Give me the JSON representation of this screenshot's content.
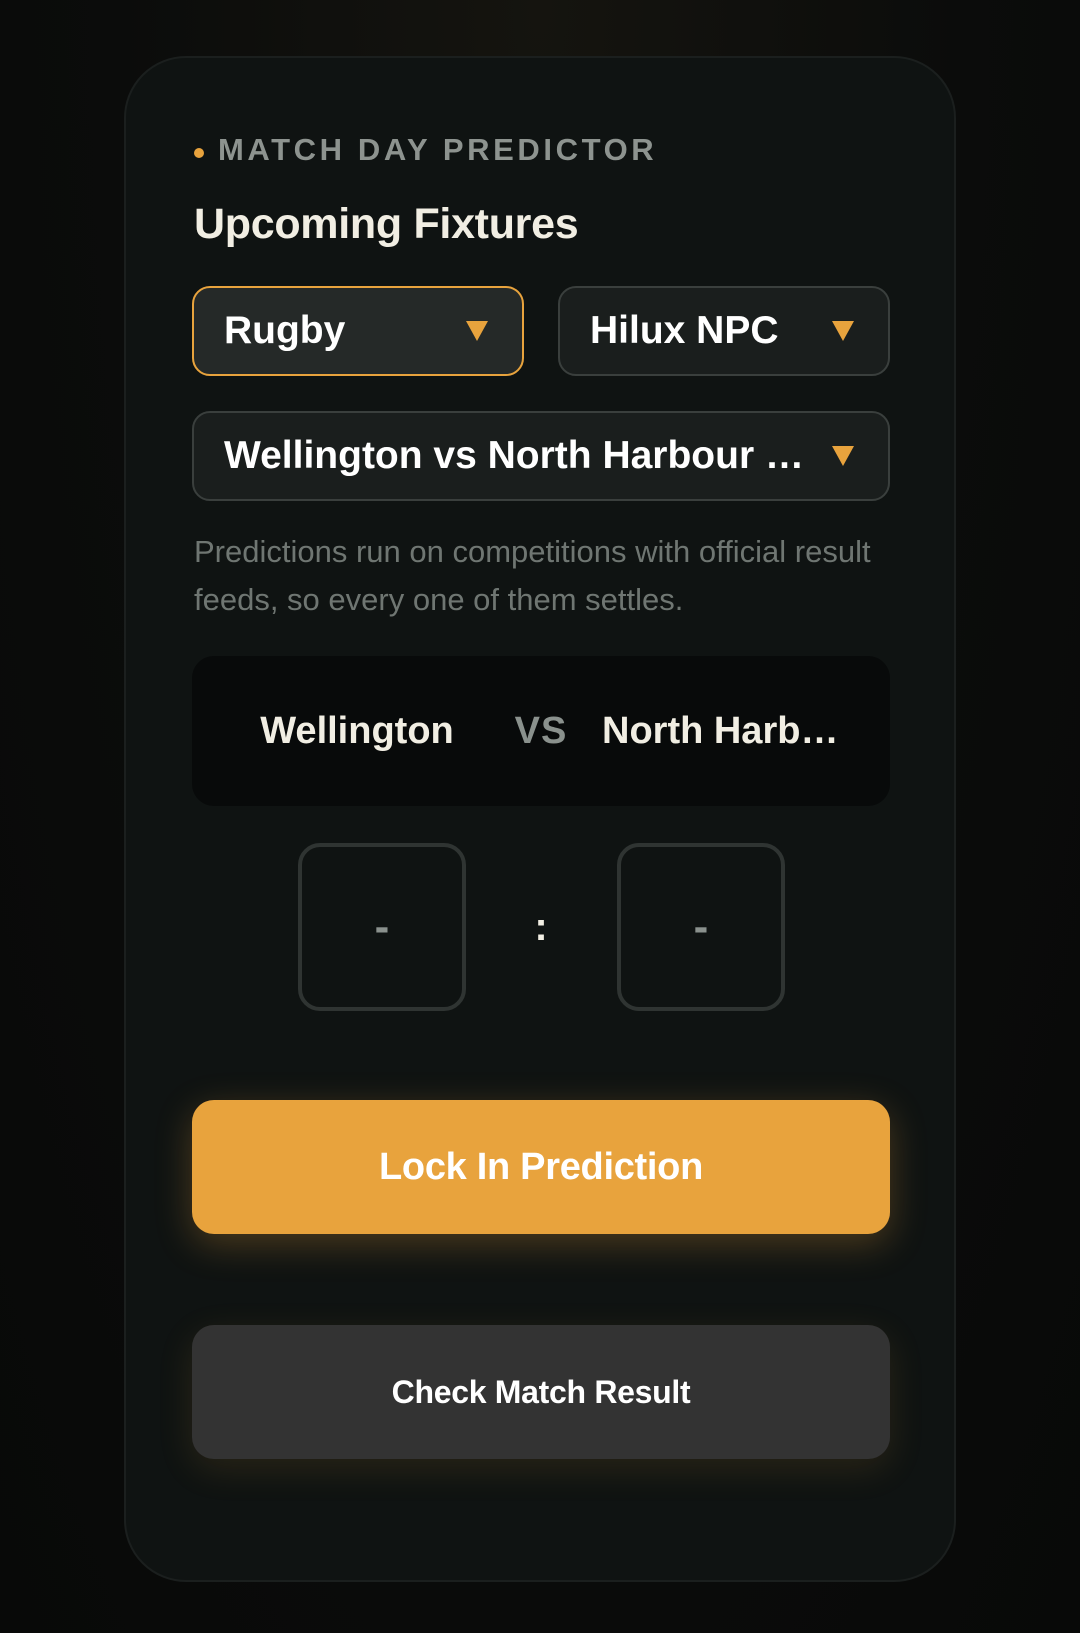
{
  "colors": {
    "accent": "#e8a33d",
    "card_background": "#0f1312",
    "secondary_button": "#333333"
  },
  "header": {
    "eyebrow": "MATCH DAY PREDICTOR",
    "title": "Upcoming Fixtures"
  },
  "filters": {
    "sport": "Rugby",
    "competition": "Hilux NPC",
    "fixture": "Wellington vs North Harbour — …"
  },
  "note": "Predictions run on competitions with official result feeds, so every one of them settles.",
  "matchup": {
    "home_team": "Wellington",
    "vs_label": "VS",
    "away_team": "North Harb…"
  },
  "prediction": {
    "home_score": "-",
    "separator": ":",
    "away_score": "-"
  },
  "actions": {
    "lock_label": "Lock In Prediction",
    "check_label": "Check Match Result"
  },
  "icons": {
    "dropdown": "chevron-down-icon",
    "eyebrow_marker": "dot-icon"
  }
}
